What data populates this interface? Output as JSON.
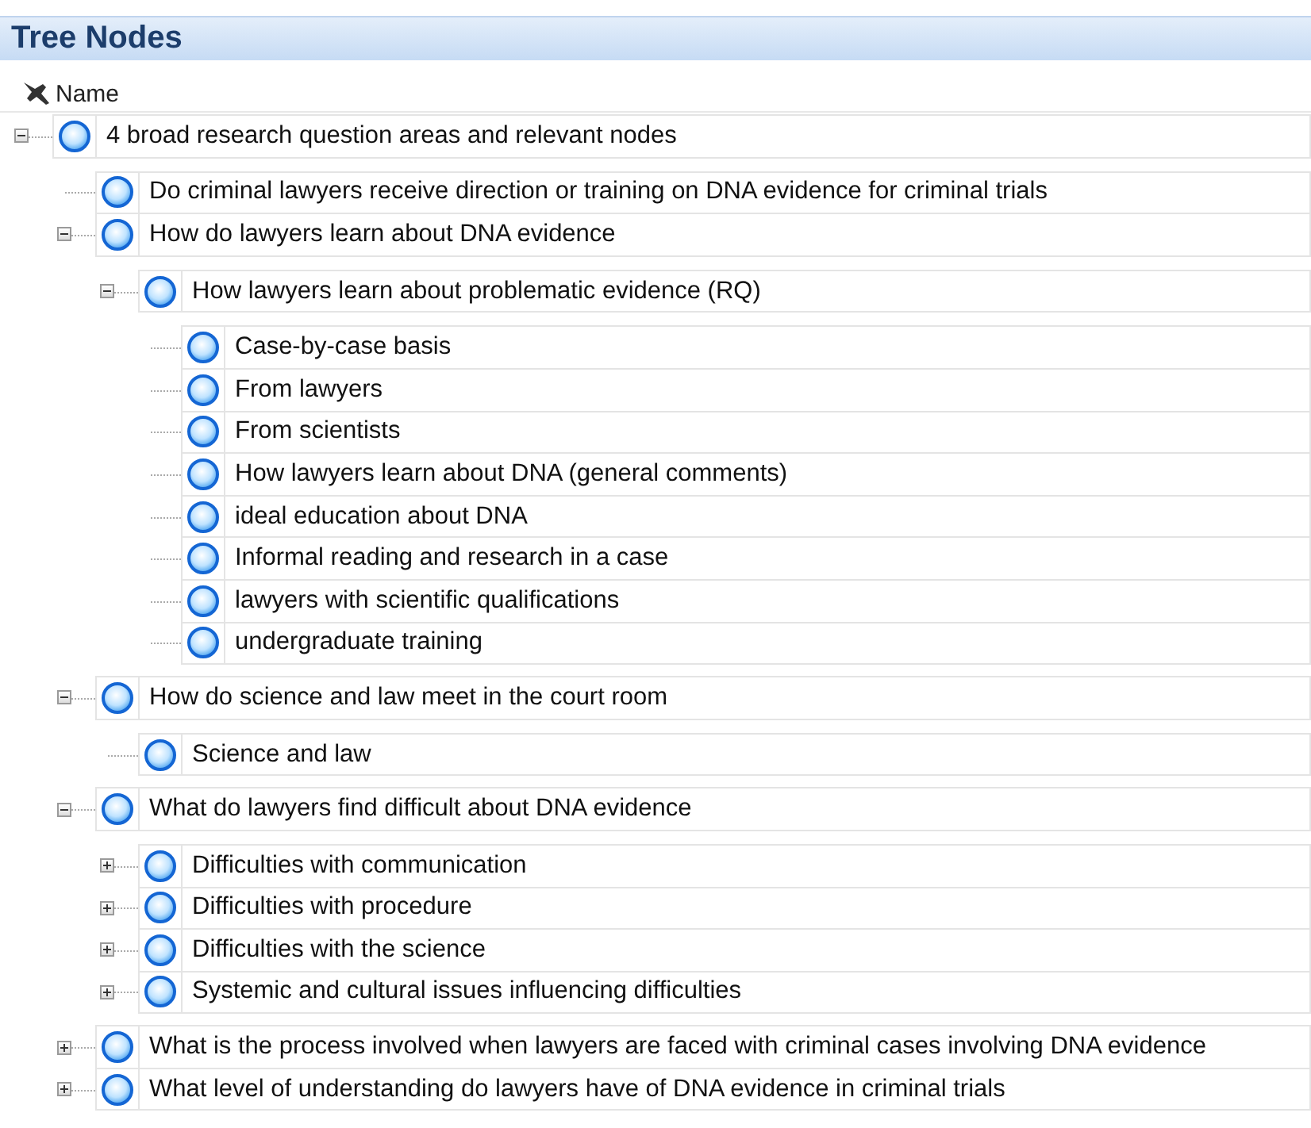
{
  "panel": {
    "title": "Tree Nodes"
  },
  "column": {
    "label": "Name"
  },
  "nodes": [
    {
      "label": "4 broad research question areas and relevant nodes",
      "expanded": true,
      "children": [
        {
          "label": "Do criminal lawyers receive direction or training on DNA evidence for criminal trials"
        },
        {
          "label": "How do lawyers learn about DNA evidence",
          "expanded": true,
          "children": [
            {
              "label": "How lawyers learn about problematic evidence (RQ)",
              "expanded": true,
              "children": [
                {
                  "label": "Case-by-case basis"
                },
                {
                  "label": "From lawyers"
                },
                {
                  "label": "From scientists"
                },
                {
                  "label": "How lawyers learn about DNA (general comments)"
                },
                {
                  "label": "ideal education about DNA"
                },
                {
                  "label": "Informal reading and research in a case"
                },
                {
                  "label": "lawyers with scientific qualifications"
                },
                {
                  "label": "undergraduate training"
                }
              ]
            }
          ]
        },
        {
          "label": "How do science and law meet in the court room",
          "expanded": true,
          "children": [
            {
              "label": "Science and law"
            }
          ]
        },
        {
          "label": "What do lawyers find difficult about DNA evidence",
          "expanded": true,
          "children": [
            {
              "label": "Difficulties with communication",
              "expanded": false
            },
            {
              "label": "Difficulties with procedure",
              "expanded": false
            },
            {
              "label": "Difficulties with the science",
              "expanded": false
            },
            {
              "label": "Systemic and cultural issues influencing difficulties",
              "expanded": false
            }
          ]
        },
        {
          "label": "What is the process involved when lawyers are faced with criminal cases involving DNA evidence",
          "expanded": false
        },
        {
          "label": "What level of understanding do lawyers have of DNA evidence in criminal trials",
          "expanded": false
        }
      ]
    }
  ]
}
